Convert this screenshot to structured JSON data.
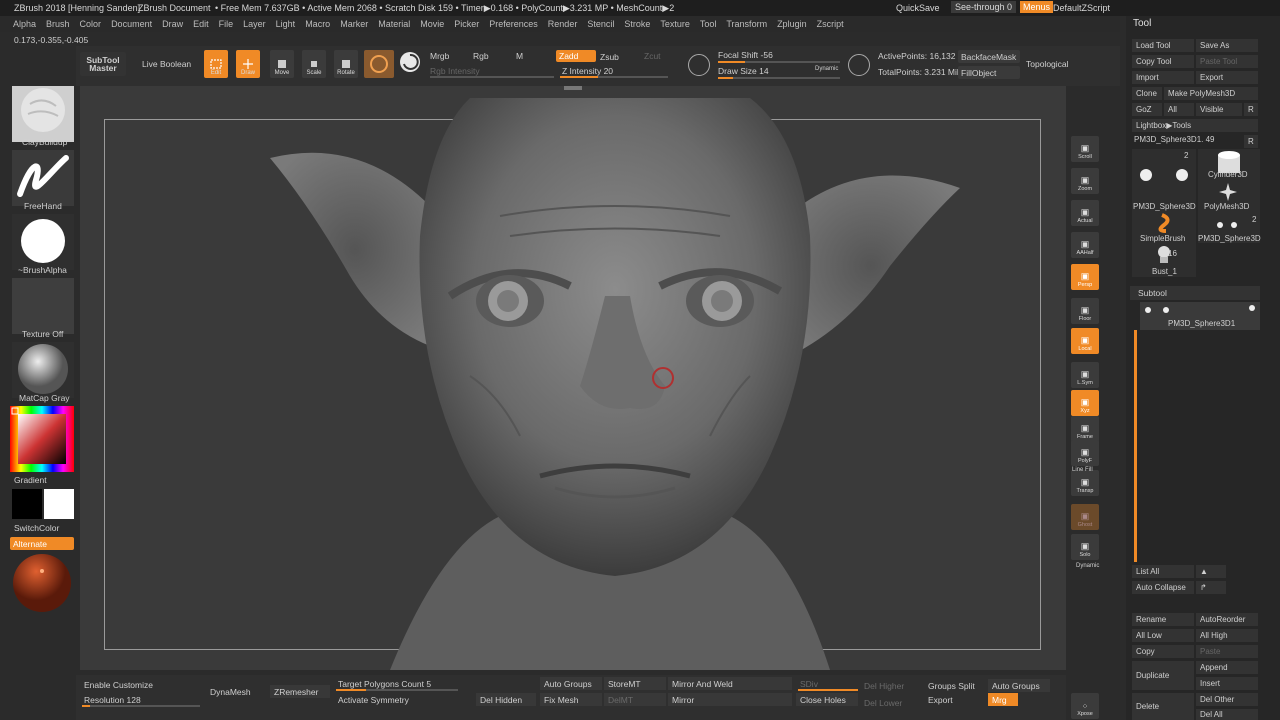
{
  "titlebar": {
    "app": "ZBrush 2018 [Henning Sanden]",
    "document": "ZBrush Document",
    "stats": "• Free Mem 7.637GB • Active Mem 2068 • Scratch Disk 159 • Timer▶0.168 • PolyCount▶3.231 MP • MeshCount▶2",
    "quicksave": "QuickSave",
    "see_through": "See-through  0",
    "menus": "Menus",
    "script": "DefaultZScript"
  },
  "menubar": [
    "Alpha",
    "Brush",
    "Color",
    "Document",
    "Draw",
    "Edit",
    "File",
    "Layer",
    "Light",
    "Macro",
    "Marker",
    "Material",
    "Movie",
    "Picker",
    "Preferences",
    "Render",
    "Stencil",
    "Stroke",
    "Texture",
    "Tool",
    "Transform",
    "Zplugin",
    "Zscript"
  ],
  "coords": "0.173,-0.355,-0.405",
  "topbar": {
    "subtool_master": "SubTool Master",
    "live_boolean": "Live Boolean",
    "edit": "Edit",
    "draw": "Draw",
    "move": "Move",
    "scale": "Scale",
    "rotate": "Rotate",
    "mrgb": "Mrgb",
    "rgb": "Rgb",
    "m": "M",
    "zadd": "Zadd",
    "zsub": "Zsub",
    "zcut": "Zcut",
    "rgb_intensity": "Rgb Intensity",
    "z_intensity": "Z Intensity 20",
    "focal_shift": "Focal Shift -56",
    "draw_size": "Draw Size 14",
    "dynamic": "Dynamic",
    "active_points": "ActivePoints: 16,132",
    "total_points": "TotalPoints: 3.231 Mil",
    "backface_mask": "BackfaceMask",
    "fill_object": "FillObject",
    "topological": "Topological",
    "z_intensity_value": 0.35,
    "focal_shift_value": 0.22,
    "draw_size_value": 0.12
  },
  "leftshelf": {
    "brush": "ClayBuildup",
    "stroke": "FreeHand",
    "alpha": "~BrushAlpha",
    "texture": "Texture Off",
    "material": "MatCap Gray",
    "gradient": "Gradient",
    "switch_color": "SwitchColor",
    "alternate": "Alternate"
  },
  "rightshelf": [
    "Scroll",
    "Zoom",
    "Actual",
    "AAHalf",
    "Persp",
    "Floor",
    "Local",
    "L.Sym",
    "Xyz",
    "Frame",
    "PolyF",
    "Transp",
    "Ghost",
    "Solo"
  ],
  "rightshelf_extra": {
    "line_fill": "Line Fill",
    "dynamic": "Dynamic"
  },
  "toolpanel": {
    "title": "Tool",
    "load_tool": "Load Tool",
    "save_as": "Save As",
    "copy_tool": "Copy Tool",
    "paste_tool": "Paste Tool",
    "import": "Import",
    "export": "Export",
    "clone": "Clone",
    "make_polymesh": "Make PolyMesh3D",
    "goz": "GoZ",
    "all": "All",
    "visible": "Visible",
    "r": "R",
    "lightbox_tools": "Lightbox▶Tools",
    "current_tool": "PM3D_Sphere3D1. 49",
    "tools": [
      {
        "name": "PM3D_Sphere3D",
        "count": "2"
      },
      {
        "name": "Cylinder3D",
        "count": ""
      },
      {
        "name": "PolyMesh3D",
        "count": ""
      },
      {
        "name": "SimpleBrush",
        "count": ""
      },
      {
        "name": "PM3D_Sphere3D",
        "count": "2"
      },
      {
        "name": "Bust_1",
        "count": "16"
      }
    ],
    "subtool_header": "Subtool",
    "subtool_item": "PM3D_Sphere3D1",
    "list_all": "List All",
    "auto_collapse": "Auto Collapse",
    "rename": "Rename",
    "auto_reorder": "AutoReorder",
    "all_low": "All Low",
    "all_high": "All High",
    "copy": "Copy",
    "paste": "Paste",
    "duplicate": "Duplicate",
    "append": "Append",
    "insert": "Insert",
    "delete": "Delete",
    "del_other": "Del Other",
    "del_all": "Del All"
  },
  "bottombar": {
    "enable_customize": "Enable Customize",
    "resolution": "Resolution 128",
    "dynamesh": "DynaMesh",
    "zremesher": "ZRemesher",
    "target_polygons": "Target Polygons Count 5",
    "activate_symmetry": "Activate Symmetry",
    "del_hidden": "Del Hidden",
    "auto_groups": "Auto Groups",
    "fix_mesh": "Fix Mesh",
    "store_mt": "StoreMT",
    "del_mt": "DelMT",
    "mirror_and_weld": "Mirror And Weld",
    "mirror": "Mirror",
    "sdiv": "SDiv",
    "close_holes": "Close Holes",
    "del_higher": "Del Higher",
    "del_lower": "Del Lower",
    "groups_split": "Groups Split",
    "auto_groups2": "Auto Groups",
    "export": "Export",
    "mrg": "Mrg",
    "xpose": "Xpose"
  },
  "colors": {
    "accent": "#f08a26",
    "bg": "#2b2b2b",
    "canvas": "#3a3a3a"
  }
}
